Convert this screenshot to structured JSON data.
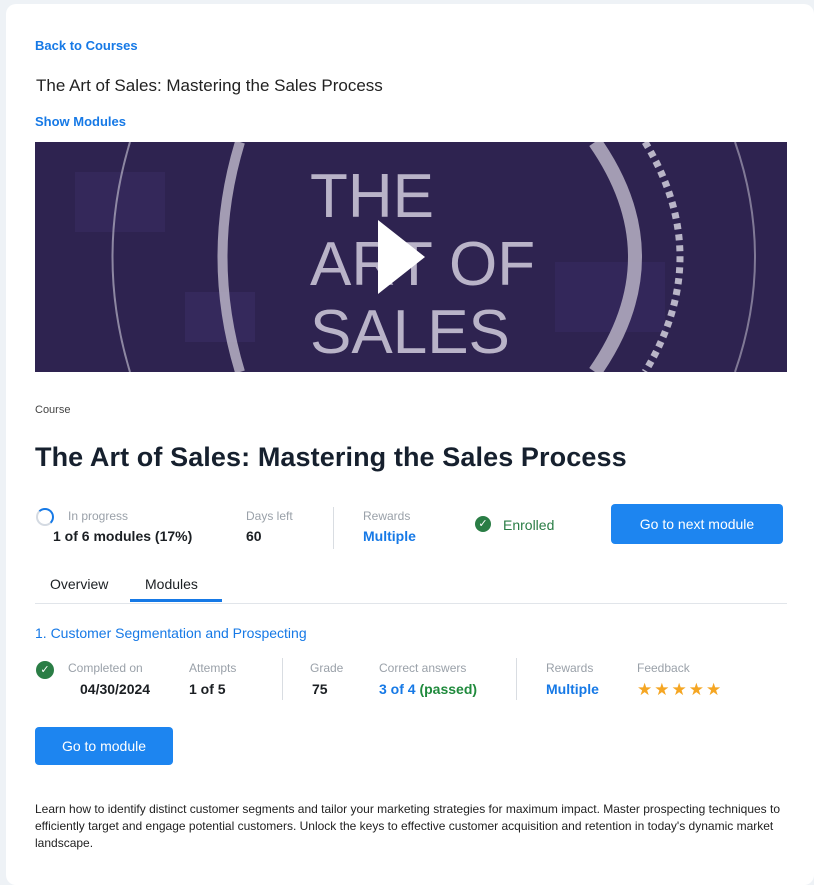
{
  "nav": {
    "back_label": "Back to Courses",
    "top_title": "The Art of Sales: Mastering the Sales Process",
    "show_modules_label": "Show Modules"
  },
  "video": {
    "title_lines": [
      "THE",
      "ART OF",
      "SALES"
    ],
    "background": "#2e2350",
    "play_icon": "play-icon"
  },
  "course": {
    "label": "Course",
    "title": "The Art of Sales: Mastering the Sales Process",
    "progress_status": "In progress",
    "progress_value": "1 of 6 modules (17%)",
    "progress_fraction": 0.17,
    "days_left_label": "Days left",
    "days_left_value": "60",
    "rewards_label": "Rewards",
    "rewards_value": "Multiple",
    "enrolled_label": "Enrolled",
    "next_module_button": "Go to next module"
  },
  "tabs": [
    {
      "label": "Overview",
      "active": false
    },
    {
      "label": "Modules",
      "active": true
    }
  ],
  "module": {
    "title": "1. Customer Segmentation and Prospecting",
    "completed_label": "Completed on",
    "completed_value": "04/30/2024",
    "attempts_label": "Attempts",
    "attempts_value": "1 of 5",
    "grade_label": "Grade",
    "grade_value": "75",
    "correct_label": "Correct answers",
    "correct_value": "3 of 4",
    "correct_status": "(passed)",
    "rewards_label": "Rewards",
    "rewards_value": "Multiple",
    "feedback_label": "Feedback",
    "feedback_stars": "★★★★★",
    "feedback_rating": 5,
    "go_button": "Go to module",
    "description": "Learn how to identify distinct customer segments and tailor your marketing strategies for maximum impact. Master prospecting techniques to efficiently target and engage potential customers. Unlock the keys to effective customer acquisition and retention in today's dynamic market landscape."
  },
  "colors": {
    "accent": "#1679e6",
    "button": "#1d85f0",
    "success": "#2a7d45",
    "star": "#f5a623"
  }
}
